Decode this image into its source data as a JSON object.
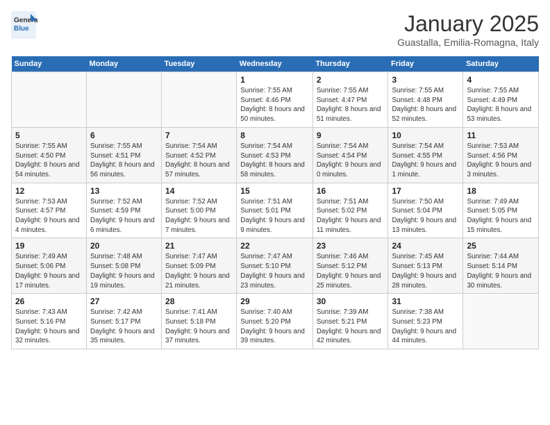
{
  "header": {
    "logo_general": "General",
    "logo_blue": "Blue",
    "month_title": "January 2025",
    "location": "Guastalla, Emilia-Romagna, Italy"
  },
  "days_of_week": [
    "Sunday",
    "Monday",
    "Tuesday",
    "Wednesday",
    "Thursday",
    "Friday",
    "Saturday"
  ],
  "weeks": [
    [
      {
        "day": "",
        "info": ""
      },
      {
        "day": "",
        "info": ""
      },
      {
        "day": "",
        "info": ""
      },
      {
        "day": "1",
        "info": "Sunrise: 7:55 AM\nSunset: 4:46 PM\nDaylight: 8 hours and 50 minutes."
      },
      {
        "day": "2",
        "info": "Sunrise: 7:55 AM\nSunset: 4:47 PM\nDaylight: 8 hours and 51 minutes."
      },
      {
        "day": "3",
        "info": "Sunrise: 7:55 AM\nSunset: 4:48 PM\nDaylight: 8 hours and 52 minutes."
      },
      {
        "day": "4",
        "info": "Sunrise: 7:55 AM\nSunset: 4:49 PM\nDaylight: 8 hours and 53 minutes."
      }
    ],
    [
      {
        "day": "5",
        "info": "Sunrise: 7:55 AM\nSunset: 4:50 PM\nDaylight: 8 hours and 54 minutes."
      },
      {
        "day": "6",
        "info": "Sunrise: 7:55 AM\nSunset: 4:51 PM\nDaylight: 8 hours and 56 minutes."
      },
      {
        "day": "7",
        "info": "Sunrise: 7:54 AM\nSunset: 4:52 PM\nDaylight: 8 hours and 57 minutes."
      },
      {
        "day": "8",
        "info": "Sunrise: 7:54 AM\nSunset: 4:53 PM\nDaylight: 8 hours and 58 minutes."
      },
      {
        "day": "9",
        "info": "Sunrise: 7:54 AM\nSunset: 4:54 PM\nDaylight: 9 hours and 0 minutes."
      },
      {
        "day": "10",
        "info": "Sunrise: 7:54 AM\nSunset: 4:55 PM\nDaylight: 9 hours and 1 minute."
      },
      {
        "day": "11",
        "info": "Sunrise: 7:53 AM\nSunset: 4:56 PM\nDaylight: 9 hours and 3 minutes."
      }
    ],
    [
      {
        "day": "12",
        "info": "Sunrise: 7:53 AM\nSunset: 4:57 PM\nDaylight: 9 hours and 4 minutes."
      },
      {
        "day": "13",
        "info": "Sunrise: 7:52 AM\nSunset: 4:59 PM\nDaylight: 9 hours and 6 minutes."
      },
      {
        "day": "14",
        "info": "Sunrise: 7:52 AM\nSunset: 5:00 PM\nDaylight: 9 hours and 7 minutes."
      },
      {
        "day": "15",
        "info": "Sunrise: 7:51 AM\nSunset: 5:01 PM\nDaylight: 9 hours and 9 minutes."
      },
      {
        "day": "16",
        "info": "Sunrise: 7:51 AM\nSunset: 5:02 PM\nDaylight: 9 hours and 11 minutes."
      },
      {
        "day": "17",
        "info": "Sunrise: 7:50 AM\nSunset: 5:04 PM\nDaylight: 9 hours and 13 minutes."
      },
      {
        "day": "18",
        "info": "Sunrise: 7:49 AM\nSunset: 5:05 PM\nDaylight: 9 hours and 15 minutes."
      }
    ],
    [
      {
        "day": "19",
        "info": "Sunrise: 7:49 AM\nSunset: 5:06 PM\nDaylight: 9 hours and 17 minutes."
      },
      {
        "day": "20",
        "info": "Sunrise: 7:48 AM\nSunset: 5:08 PM\nDaylight: 9 hours and 19 minutes."
      },
      {
        "day": "21",
        "info": "Sunrise: 7:47 AM\nSunset: 5:09 PM\nDaylight: 9 hours and 21 minutes."
      },
      {
        "day": "22",
        "info": "Sunrise: 7:47 AM\nSunset: 5:10 PM\nDaylight: 9 hours and 23 minutes."
      },
      {
        "day": "23",
        "info": "Sunrise: 7:46 AM\nSunset: 5:12 PM\nDaylight: 9 hours and 25 minutes."
      },
      {
        "day": "24",
        "info": "Sunrise: 7:45 AM\nSunset: 5:13 PM\nDaylight: 9 hours and 28 minutes."
      },
      {
        "day": "25",
        "info": "Sunrise: 7:44 AM\nSunset: 5:14 PM\nDaylight: 9 hours and 30 minutes."
      }
    ],
    [
      {
        "day": "26",
        "info": "Sunrise: 7:43 AM\nSunset: 5:16 PM\nDaylight: 9 hours and 32 minutes."
      },
      {
        "day": "27",
        "info": "Sunrise: 7:42 AM\nSunset: 5:17 PM\nDaylight: 9 hours and 35 minutes."
      },
      {
        "day": "28",
        "info": "Sunrise: 7:41 AM\nSunset: 5:18 PM\nDaylight: 9 hours and 37 minutes."
      },
      {
        "day": "29",
        "info": "Sunrise: 7:40 AM\nSunset: 5:20 PM\nDaylight: 9 hours and 39 minutes."
      },
      {
        "day": "30",
        "info": "Sunrise: 7:39 AM\nSunset: 5:21 PM\nDaylight: 9 hours and 42 minutes."
      },
      {
        "day": "31",
        "info": "Sunrise: 7:38 AM\nSunset: 5:23 PM\nDaylight: 9 hours and 44 minutes."
      },
      {
        "day": "",
        "info": ""
      }
    ]
  ]
}
